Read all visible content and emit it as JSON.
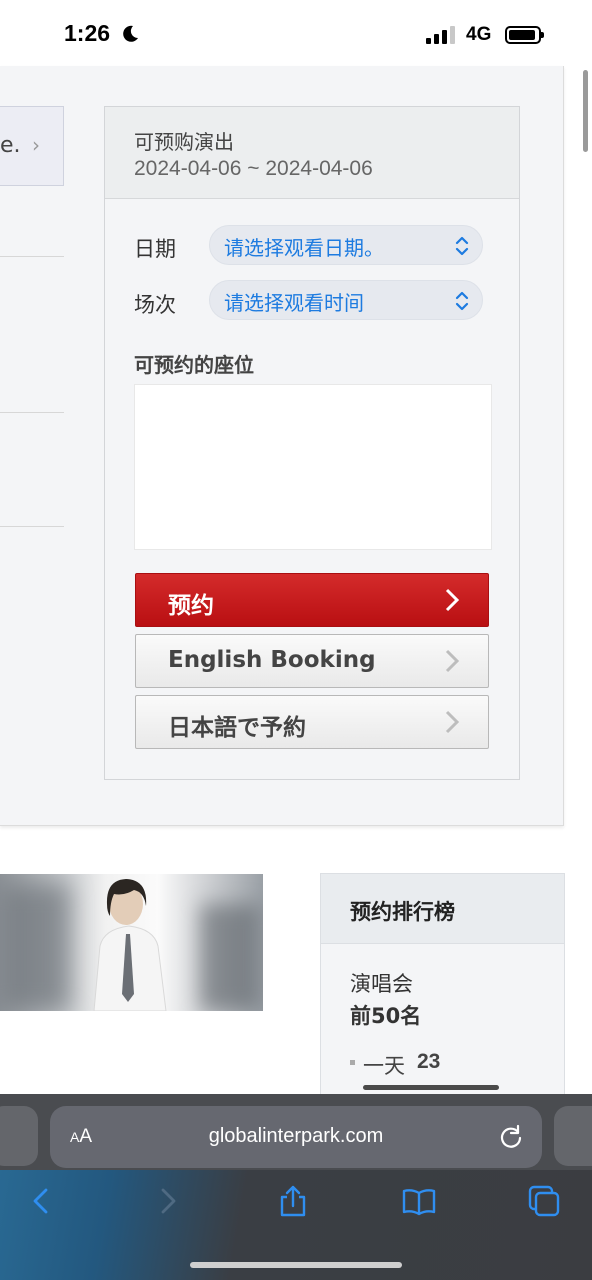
{
  "status_bar": {
    "time": "1:26",
    "network": "4G",
    "signal_bars_active": 3,
    "signal_bars_total": 4
  },
  "left_card": {
    "text": "e.",
    "chevron": "›"
  },
  "booking": {
    "title": "可预购演出",
    "date_range": "2024-04-06 ~ 2024-04-06",
    "date_label": "日期",
    "date_placeholder": "请选择观看日期。",
    "session_label": "场次",
    "session_placeholder": "请选择观看时间",
    "seats_label": "可预约的座位",
    "buttons": {
      "book": "预约",
      "english": "English Booking",
      "japanese": "日本語で予約"
    }
  },
  "ranking": {
    "title": "预约排行榜",
    "category": "演唱会",
    "top_label": "前50名",
    "day_label": "一天",
    "day_value": "23"
  },
  "browser": {
    "aa_small": "A",
    "aa_big": "A",
    "url": "globalinterpark.com"
  },
  "colors": {
    "accent_red": "#c8181b",
    "link_blue": "#1d7be0",
    "ios_blue": "#2f8ef0"
  }
}
